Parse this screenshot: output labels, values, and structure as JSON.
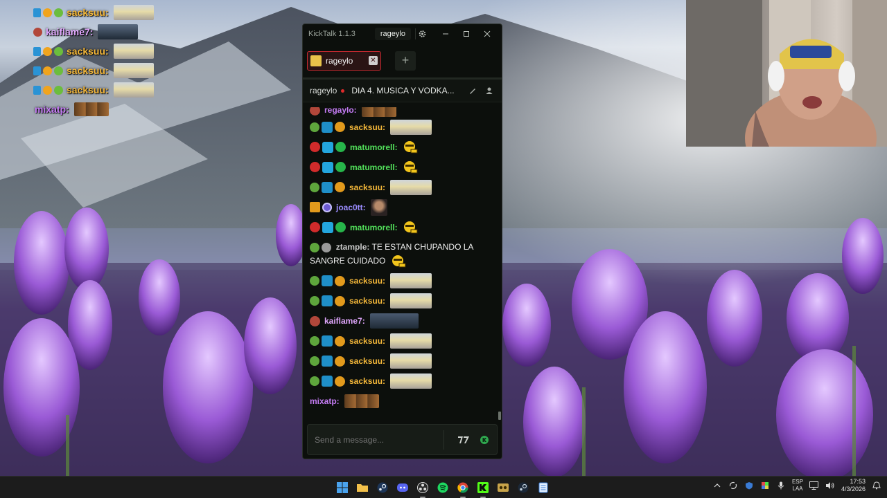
{
  "overlay_chat": [
    {
      "user": "sacksuu:",
      "color": "#f6b93a",
      "badges": [
        "sword",
        "coin",
        "alien"
      ],
      "emote": "cat-wide"
    },
    {
      "user": "kaiflame7:",
      "color": "#e2a8ff",
      "badges": [
        "bear"
      ],
      "emote": "dark-wide"
    },
    {
      "user": "sacksuu:",
      "color": "#f6b93a",
      "badges": [
        "sword",
        "coin",
        "alien"
      ],
      "emote": "cat-wide"
    },
    {
      "user": "sacksuu:",
      "color": "#f6b93a",
      "badges": [
        "sword",
        "coin",
        "alien"
      ],
      "emote": "cat-wide"
    },
    {
      "user": "sacksuu:",
      "color": "#f6b93a",
      "badges": [
        "sword",
        "coin",
        "alien"
      ],
      "emote": "cat-wide"
    },
    {
      "user": "mixatp:",
      "color": "#c57cf5",
      "badges": [],
      "emote": "trio"
    }
  ],
  "kicktalk": {
    "app_title": "KickTalk 1.1.3",
    "current_user": "rageylo",
    "tab": {
      "label": "rageylo"
    },
    "add_tab": "+",
    "stream": {
      "channel": "rageylo",
      "title": "DIA 4. MUSICA Y VODKA..."
    },
    "messages": [
      {
        "user": "regaylo:",
        "color": "#c57cf5",
        "badges": [
          "bear"
        ],
        "emote": "trio"
      },
      {
        "user": "sacksuu:",
        "color": "#f6b93a",
        "badges": [
          "alien",
          "sword",
          "coin"
        ],
        "emote": "cat-wide"
      },
      {
        "user": "matumorell:",
        "color": "#52e05a",
        "badges": [
          "bear",
          "cube",
          "verified"
        ],
        "emote": "face"
      },
      {
        "user": "matumorell:",
        "color": "#52e05a",
        "badges": [
          "bear",
          "cube",
          "verified"
        ],
        "emote": "face"
      },
      {
        "user": "sacksuu:",
        "color": "#f6b93a",
        "badges": [
          "alien",
          "sword",
          "coin"
        ],
        "emote": "cat-wide"
      },
      {
        "user": "joac0tt:",
        "color": "#9b8cff",
        "badges": [
          "kick",
          "ring"
        ],
        "emote": "person"
      },
      {
        "user": "matumorell:",
        "color": "#52e05a",
        "badges": [
          "bear",
          "cube",
          "verified"
        ],
        "emote": "face"
      },
      {
        "user": "ztample:",
        "color": "#c9c9c9",
        "badges": [
          "alien",
          "gray"
        ],
        "text": "TE ESTAN CHUPANDO LA SANGRE CUIDADO",
        "emote": "face"
      },
      {
        "user": "sacksuu:",
        "color": "#f6b93a",
        "badges": [
          "alien",
          "sword",
          "coin"
        ],
        "emote": "cat-wide"
      },
      {
        "user": "sacksuu:",
        "color": "#f6b93a",
        "badges": [
          "alien",
          "sword",
          "coin"
        ],
        "emote": "cat-wide"
      },
      {
        "user": "kaiflame7:",
        "color": "#e2a8ff",
        "badges": [
          "bear"
        ],
        "emote": "dark-wide"
      },
      {
        "user": "sacksuu:",
        "color": "#f6b93a",
        "badges": [
          "alien",
          "sword",
          "coin"
        ],
        "emote": "cat-wide"
      },
      {
        "user": "sacksuu:",
        "color": "#f6b93a",
        "badges": [
          "alien",
          "sword",
          "coin"
        ],
        "emote": "cat-wide"
      },
      {
        "user": "sacksuu:",
        "color": "#f6b93a",
        "badges": [
          "alien",
          "sword",
          "coin"
        ],
        "emote": "cat-wide"
      },
      {
        "user": "mixatp:",
        "color": "#c57cf5",
        "badges": [],
        "emote": "trio"
      }
    ],
    "input_placeholder": "Send a message...",
    "input_buttons": [
      "7tv-button",
      "kick-emote-button"
    ]
  },
  "taskbar": {
    "apps": [
      "start",
      "file-explorer",
      "steam",
      "discord",
      "obs",
      "spotify",
      "chrome",
      "kick",
      "game",
      "steam-2",
      "notepad"
    ],
    "lang": {
      "line1": "ESP",
      "line2": "LAA"
    },
    "time": "17:53",
    "date": "4/3/2026"
  }
}
